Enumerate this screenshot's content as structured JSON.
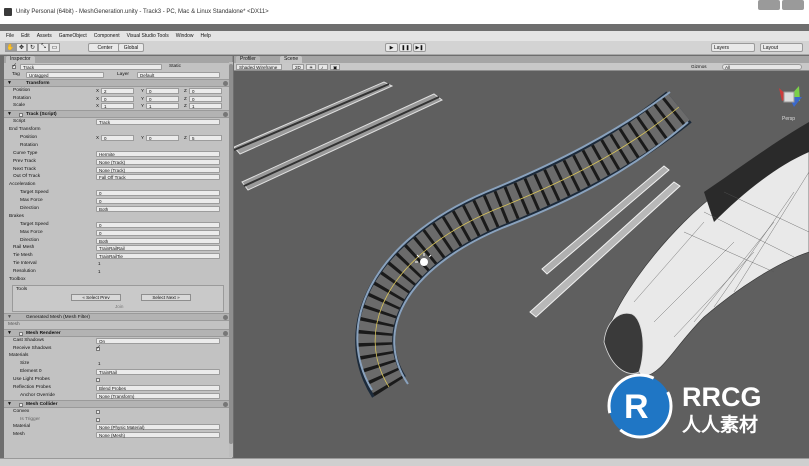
{
  "window": {
    "title": "Unity Personal (64bit) - MeshGeneration.unity - Track3 - PC, Mac & Linux Standalone* <DX11>"
  },
  "menu": [
    "File",
    "Edit",
    "Assets",
    "GameObject",
    "Component",
    "Visual Studio Tools",
    "Window",
    "Help"
  ],
  "toolbar": {
    "pivot": "Center",
    "space": "Global",
    "layers": "Layers",
    "layout": "Layout"
  },
  "inspector": {
    "tab": "Inspector",
    "object_name": "Track",
    "static_label": "Static",
    "tag_label": "Tag",
    "tag_value": "Untagged",
    "layer_label": "Layer",
    "layer_value": "Default",
    "transform": {
      "header": "Transform",
      "position": "Position",
      "rotation": "Rotation",
      "scale": "Scale",
      "pos": [
        "2",
        "0",
        "0"
      ],
      "rot": [
        "0",
        "0",
        "0"
      ],
      "scl": [
        "1",
        "1",
        "1"
      ]
    },
    "track_script": {
      "header": "Track (Script)",
      "script_label": "Script",
      "script_value": "Track",
      "end_transform": "End Transform",
      "et_position": "Position",
      "et_position_vals": [
        "0",
        "0",
        "5"
      ],
      "et_rotation": "Rotation",
      "curve_type_label": "Curve Type",
      "curve_type_value": "Hermite",
      "prev_track_label": "Prev Track",
      "prev_track_value": "None (Track)",
      "next_track_label": "Next Track",
      "next_track_value": "None (Track)",
      "out_of_track_label": "Out Of Track",
      "out_of_track_value": "Fall Off Track",
      "acceleration": "Acceleration",
      "target_speed": "Target Speed",
      "max_force": "Max Force",
      "direction": "Direction",
      "acc_target_speed": "0",
      "acc_max_force": "0",
      "acc_direction": "Both",
      "brakes": "Brakes",
      "brk_target_speed": "0",
      "brk_max_force": "0",
      "brk_direction": "Both",
      "rail_mesh_label": "Rail Mesh",
      "rail_mesh_value": "TrainRailRail",
      "tie_mesh_label": "Tie Mesh",
      "tie_mesh_value": "TrainRailTie",
      "tie_interval_label": "Tie Interval",
      "tie_interval_value": "1",
      "resolution_label": "Resolution",
      "resolution_value": "1",
      "toolbox": "Toolbox",
      "tools_label": "Tools",
      "select_prev": "« Select Prev",
      "select_next": "Select Next »",
      "join": "Join"
    },
    "mesh_filter": {
      "header": "Generated Mesh (Mesh Filter)",
      "mesh_label": "Mesh"
    },
    "mesh_renderer": {
      "header": "Mesh Renderer",
      "cast_shadows_label": "Cast Shadows",
      "cast_shadows_value": "On",
      "receive_shadows_label": "Receive Shadows",
      "materials_label": "Materials",
      "size_label": "Size",
      "size_value": "1",
      "element0_label": "Element 0",
      "element0_value": "TrainRail",
      "use_lightprobes_label": "Use Light Probes",
      "reflection_probes_label": "Reflection Probes",
      "reflection_probes_value": "Blend Probes",
      "anchor_override_label": "Anchor Override",
      "anchor_override_value": "None (Transform)"
    },
    "mesh_collider": {
      "header": "Mesh Collider",
      "convex_label": "Convex",
      "is_trigger_label": "Is Trigger",
      "material_label": "Material",
      "material_value": "None (Physic Material)",
      "mesh_label": "Mesh",
      "mesh_value": "None (Mesh)"
    }
  },
  "scene": {
    "tab_profiler": "Profiler",
    "tab_scene": "Scene",
    "shading": "Shaded Wireframe",
    "mode": "2D",
    "gizmos": "Gizmos",
    "search_placeholder": "All",
    "persp": "Persp"
  },
  "watermark": {
    "brand": "RRCG",
    "subtitle": "人人素材"
  }
}
